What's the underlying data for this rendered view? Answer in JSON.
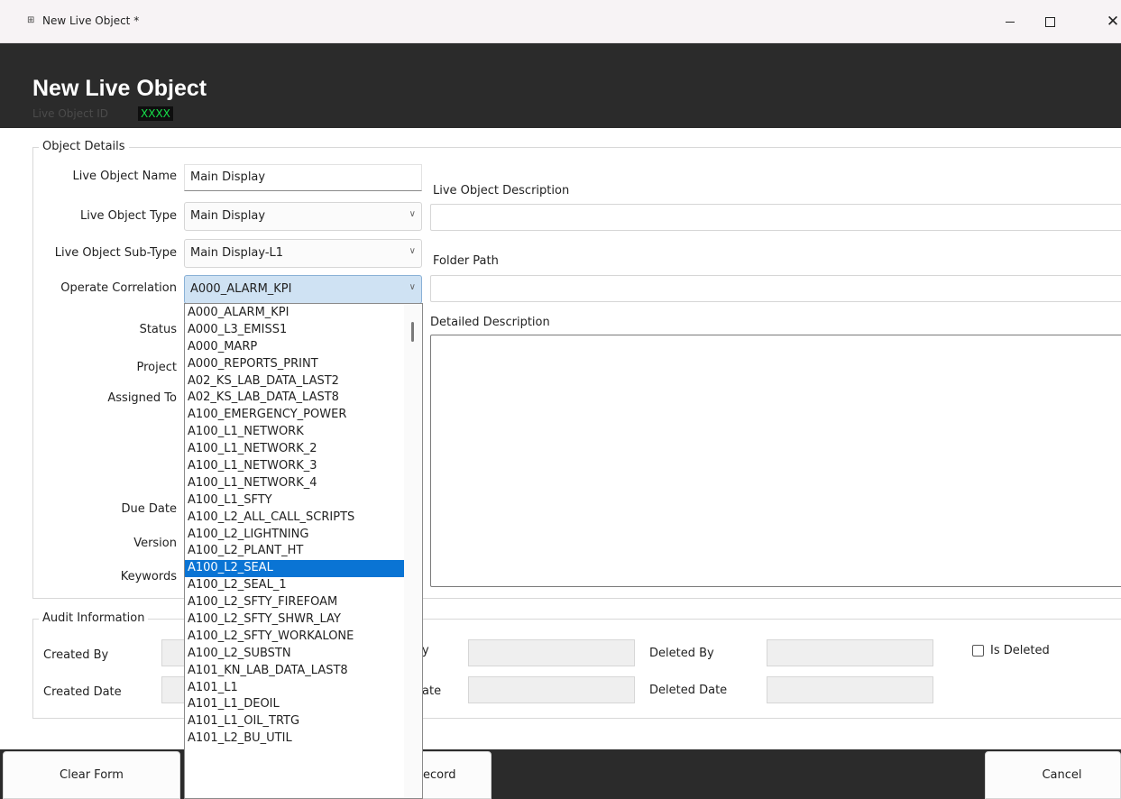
{
  "window": {
    "title": "New Live Object *",
    "icon": "app-grid-icon"
  },
  "header": {
    "title": "New Live Object",
    "id_label": "Live Object ID",
    "id_value": "XXXX"
  },
  "object_details": {
    "legend": "Object Details",
    "name_label": "Live Object Name",
    "name_value": "Main Display",
    "type_label": "Live Object Type",
    "type_value": "Main Display",
    "subtype_label": "Live Object Sub-Type",
    "subtype_value": "Main Display-L1",
    "correlation_label": "Operate Correlation",
    "correlation_value": "A000_ALARM_KPI",
    "status_label": "Status",
    "project_label": "Project",
    "assigned_label": "Assigned To",
    "due_label": "Due Date",
    "version_label": "Version",
    "keywords_label": "Keywords",
    "description_label": "Live Object Description",
    "folder_label": "Folder Path",
    "detailed_label": "Detailed Description"
  },
  "dropdown": {
    "selected_index": 17,
    "items": [
      "A000_ALARM_KPI",
      "A000_L3_EMISS1",
      "A000_MARP",
      "A000_REPORTS_PRINT",
      "A02_KS_LAB_DATA_LAST2",
      "A02_KS_LAB_DATA_LAST8",
      "A100_EMERGENCY_POWER",
      "A100_L1_NETWORK",
      "A100_L1_NETWORK_2",
      "A100_L1_NETWORK_3",
      "A100_L1_NETWORK_4",
      "A100_L1_SFTY",
      "A100_L2_ALL_CALL_SCRIPTS",
      "A100_L2_LIGHTNING",
      "A100_L2_PLANT_HT",
      "A100_L2_SEAL",
      "A100_L2_SEAL_1",
      "A100_L2_SFTY_FIREFOAM",
      "A100_L2_SFTY_SHWR_LAY",
      "A100_L2_SFTY_WORKALONE",
      "A100_L2_SUBSTN",
      "A101_KN_LAB_DATA_LAST8",
      "A101_L1",
      "A101_L1_DEOIL",
      "A101_L1_OIL_TRTG",
      "A101_L2_BU_UTIL"
    ]
  },
  "audit": {
    "legend": "Audit Information",
    "created_by_label": "Created By",
    "created_date_label": "Created Date",
    "modified_by_label_partial": "y",
    "modified_date_label_partial": "ate",
    "deleted_by_label": "Deleted By",
    "deleted_date_label": "Deleted Date",
    "is_deleted_label": "Is Deleted"
  },
  "footer": {
    "clear_label": "Clear Form",
    "record_label_partial": "ecord",
    "cancel_label": "Cancel"
  }
}
